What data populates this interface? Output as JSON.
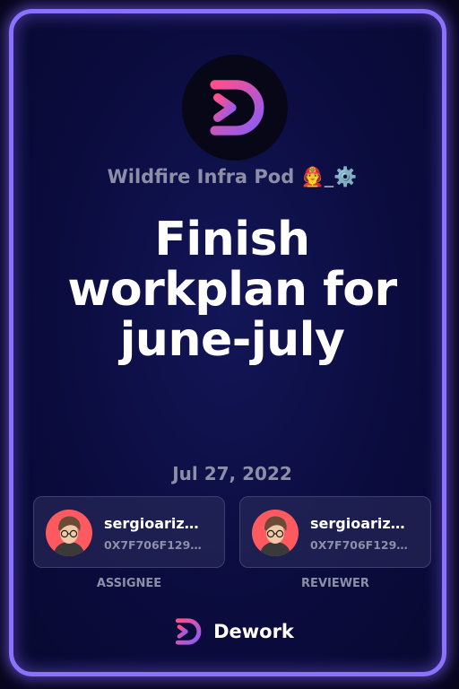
{
  "workspace": {
    "name": "Wildfire Infra Pod 🧑‍🚒_⚙️"
  },
  "task": {
    "title": "Finish workplan for june-july",
    "date": "Jul 27, 2022"
  },
  "assignee": {
    "name": "sergioariz…",
    "address": "0X7F706F129…",
    "role": "ASSIGNEE"
  },
  "reviewer": {
    "name": "sergioariz…",
    "address": "0X7F706F129…",
    "role": "REVIEWER"
  },
  "brand": {
    "name": "Dework"
  },
  "colors": {
    "accent_border": "#8a72ff",
    "background": "#0b0c3f",
    "logo_gradient_start": "#ff4f8b",
    "logo_gradient_end": "#8b5cf6",
    "muted_text": "#8d8ea8",
    "avatar_bg": "#ff5a5f"
  },
  "icons": [
    "dework-logo-icon",
    "avatar-icon"
  ]
}
